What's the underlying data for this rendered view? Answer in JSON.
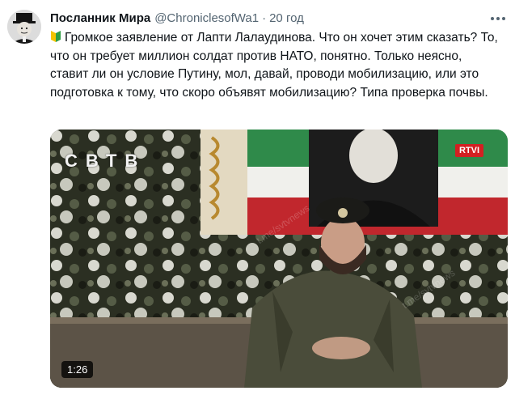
{
  "tweet": {
    "author_name": "Посланник Мира",
    "author_handle": "@ChroniclesofWa1",
    "separator": "·",
    "time": "20 год",
    "text": "Громкое заявление от Лапти Лалаудинова. Что он хочет этим сказать? То, что он требует миллион солдат против НАТО, понятно. Только неясно, ставит ли он условие Путину, мол, давай, проводи мобилизацию, или это подготовка к тому, что скоро объявят мобилизацию? Типа проверка почвы.",
    "leading_icon": "japanese-beginner-badge-icon",
    "more_icon": "more-options-icon"
  },
  "video": {
    "logo": "СВТВ",
    "channel_badge": "RTVI",
    "duration": "1:26",
    "watermark": "t.me/svtvnews"
  },
  "colors": {
    "background": "#ffffff",
    "text": "#0f1419",
    "secondary_text": "#536471",
    "channel_badge": "#d32022"
  }
}
